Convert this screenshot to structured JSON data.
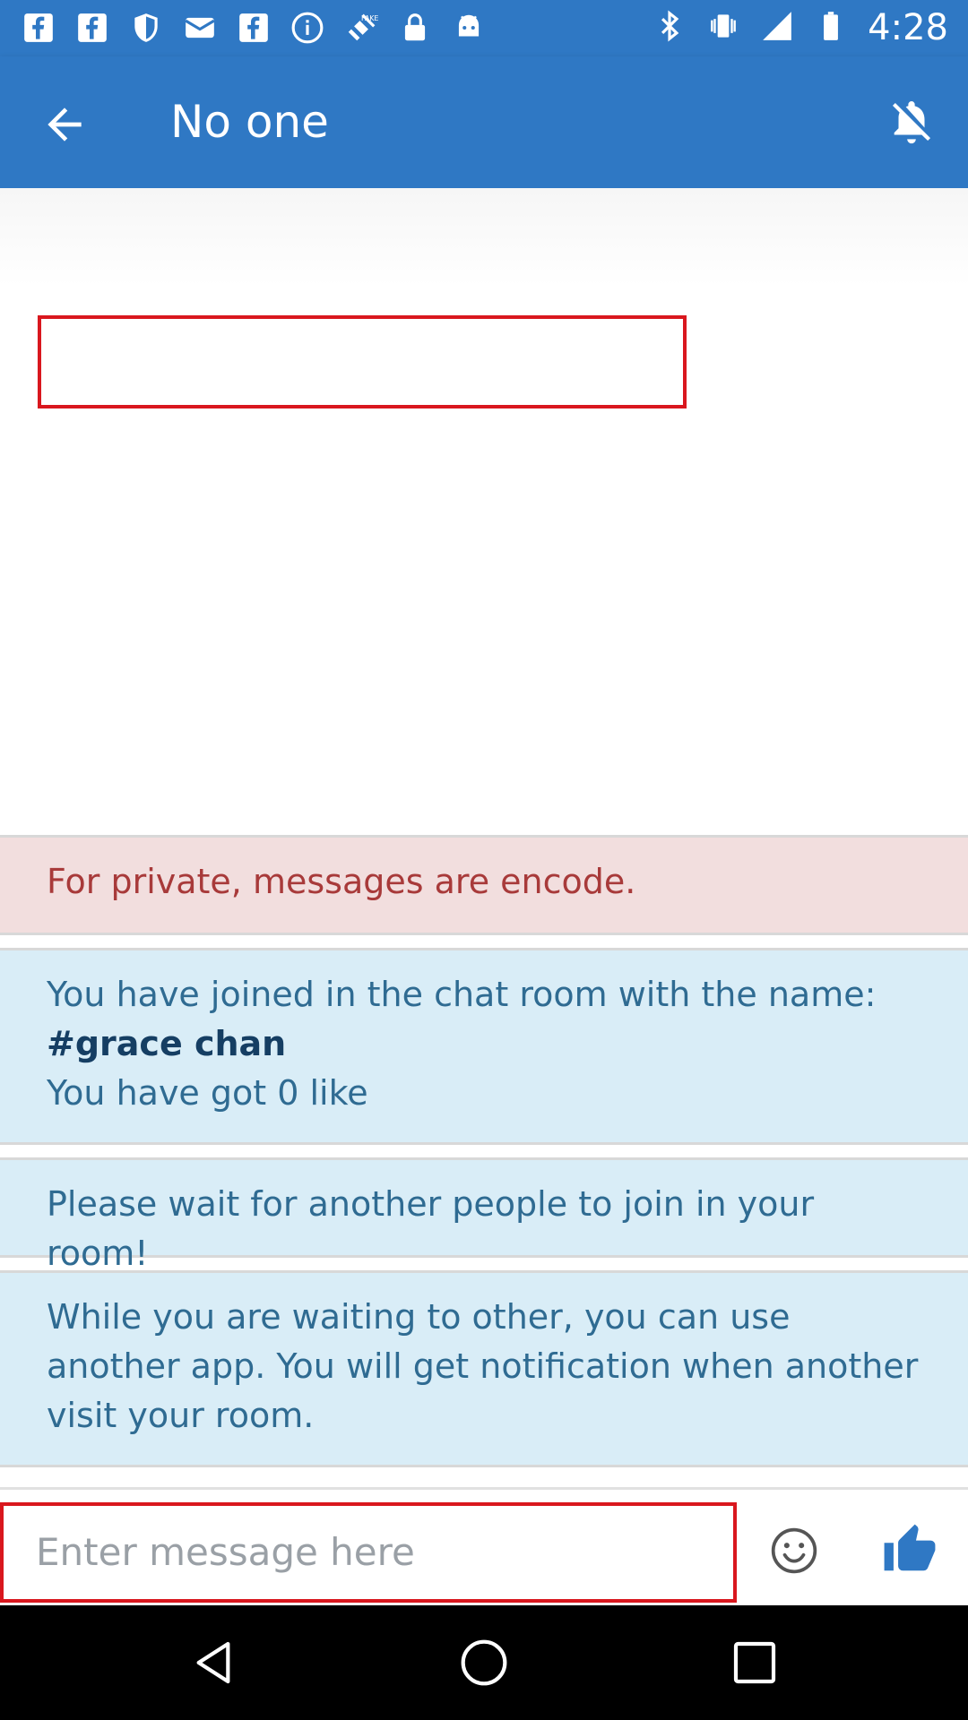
{
  "status_bar": {
    "time": "4:28",
    "icons_left": [
      "facebook-icon",
      "facebook-icon",
      "shield-icon",
      "mail-icon",
      "facebook-icon",
      "info-icon",
      "satellite-fake-gps-icon",
      "lock-icon",
      "android-icon"
    ],
    "icons_right": [
      "bluetooth-icon",
      "vibrate-icon",
      "signal-icon",
      "battery-icon"
    ]
  },
  "app_bar": {
    "title": "No one",
    "back_icon": "arrow-back-icon",
    "notification_icon": "notifications-off-icon"
  },
  "messages": {
    "private_notice": "For private, messages are encode.",
    "joined_line1": "You have joined in the chat room with the name:",
    "joined_name": "#grace chan",
    "joined_likes": "You have got 0 like",
    "wait_notice": "Please wait for another people to join in your room!",
    "waiting_info": "While you are waiting to other, you can use another app. You will get notification when another visit your room."
  },
  "composer": {
    "placeholder": "Enter message here",
    "emoji_icon": "emoji-icon",
    "like_icon": "thumbs-up-icon"
  },
  "colors": {
    "primary": "#2f78c4",
    "pink_bg": "#f2dede",
    "pink_text": "#a83a3a",
    "blue_bg": "#d9edf7",
    "blue_text": "#2f6b92",
    "highlight_red": "#d9171e"
  }
}
